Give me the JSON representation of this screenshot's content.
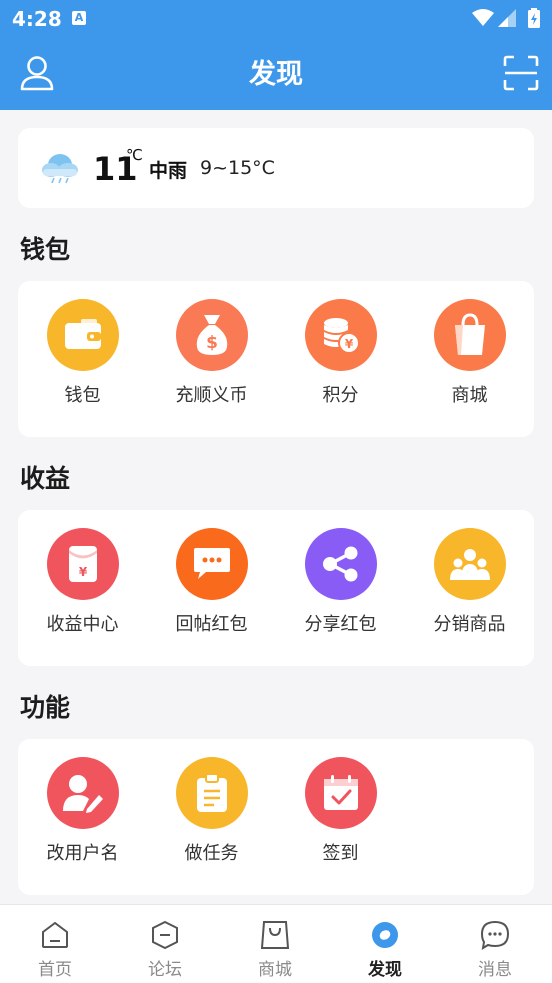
{
  "status_bar": {
    "time": "4:28",
    "notification_icon": "A"
  },
  "header": {
    "title": "发现",
    "left_icon": "user-icon",
    "right_icon": "scan-icon"
  },
  "weather": {
    "temperature": "11",
    "unit": "℃",
    "condition": "中雨",
    "range": "9~15°C",
    "icon": "rain-cloud-icon"
  },
  "sections": [
    {
      "title": "钱包",
      "items": [
        {
          "label": "钱包",
          "icon": "wallet-icon",
          "color": "#f8b62b"
        },
        {
          "label": "充顺义币",
          "icon": "money-bag-icon",
          "color": "#fa7a55"
        },
        {
          "label": "积分",
          "icon": "coins-icon",
          "color": "#fa7a4a"
        },
        {
          "label": "商城",
          "icon": "shopping-bag-icon",
          "color": "#fa7a4a"
        }
      ]
    },
    {
      "title": "收益",
      "items": [
        {
          "label": "收益中心",
          "icon": "red-envelope-icon",
          "color": "#f0555e"
        },
        {
          "label": "回帖红包",
          "icon": "chat-bubble-icon",
          "color": "#fa6a1c"
        },
        {
          "label": "分享红包",
          "icon": "share-icon",
          "color": "#8a5cf6"
        },
        {
          "label": "分销商品",
          "icon": "people-icon",
          "color": "#f8b62b"
        }
      ]
    },
    {
      "title": "功能",
      "items": [
        {
          "label": "改用户名",
          "icon": "edit-user-icon",
          "color": "#f0555e"
        },
        {
          "label": "做任务",
          "icon": "clipboard-icon",
          "color": "#f8b62b"
        },
        {
          "label": "签到",
          "icon": "calendar-check-icon",
          "color": "#f0555e"
        }
      ]
    }
  ],
  "bottom_nav": [
    {
      "label": "首页",
      "icon": "home-icon",
      "active": false
    },
    {
      "label": "论坛",
      "icon": "forum-icon",
      "active": false
    },
    {
      "label": "商城",
      "icon": "shop-icon",
      "active": false
    },
    {
      "label": "发现",
      "icon": "discover-icon",
      "active": true
    },
    {
      "label": "消息",
      "icon": "message-icon",
      "active": false
    }
  ],
  "colors": {
    "primary": "#3d97ea",
    "background": "#f5f5f7"
  }
}
